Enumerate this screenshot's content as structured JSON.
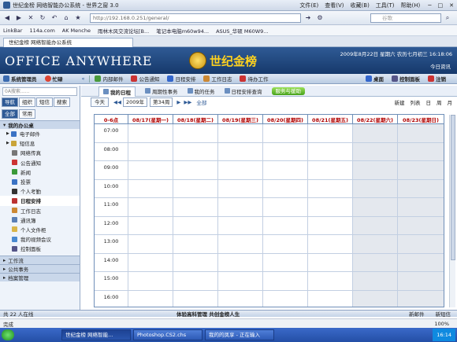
{
  "browser": {
    "title": "世纪金榜 网络智能办公系统 - 世界之窗 3.0",
    "menu": [
      "文件(E)",
      "查看(V)",
      "收藏(B)",
      "工具(T)",
      "帮助(H)"
    ],
    "address": "http://192.168.0.251/general/",
    "search_placeholder": "谷歌",
    "favorites": [
      "LinkBar",
      "114a.com",
      "AK Menche",
      "雨林木风交流论坛[B...",
      "笔记本电脑m60w94...",
      "ASUS_华硕 M60W9..."
    ],
    "tab_title": "世纪金榜 网络智能办公系统"
  },
  "header": {
    "logo": "OFFICE ANYWHERE",
    "brand": "世纪金榜",
    "date": "2009年8月22日 星期六 农历七月初三  16:18:06",
    "today_link": "今日资讯"
  },
  "nav": {
    "user": "系统管理员",
    "status": "忙碌",
    "items": [
      "内部邮件",
      "公告通知",
      "日程安排",
      "工作日志",
      "待办工作"
    ],
    "right": [
      "桌面",
      "控制面板",
      "注销"
    ]
  },
  "sidebar": {
    "search_placeholder": "0A搜索......",
    "tabs": [
      "导航",
      "组织",
      "短信",
      "搜索"
    ],
    "subtabs": [
      "全部",
      "常用"
    ],
    "section": "我的办公桌",
    "items": [
      "电子邮件",
      "短信息",
      "网络传真",
      "公告通知",
      "新闻",
      "投票",
      "个人考勤",
      "日程安排",
      "工作日志",
      "通讯簿",
      "个人文件柜",
      "我的视频会议",
      "控制面板"
    ],
    "groups": [
      "工作流",
      "公共事务",
      "档案管理"
    ]
  },
  "calendar": {
    "tabs": [
      "我的日程",
      "周期性事务",
      "我的任务",
      "日程安排查询"
    ],
    "help": "服务与援助",
    "today_button": "今天",
    "year": "2009年",
    "week": "第34周",
    "all": "全部",
    "new": "新建",
    "views": [
      "列表",
      "日",
      "周",
      "月"
    ],
    "corner": "0-6点",
    "days": [
      "08/17(星期一)",
      "08/18(星期二)",
      "08/19(星期三)",
      "08/20(星期四)",
      "08/21(星期五)",
      "08/22(星期六)",
      "08/23(星期日)"
    ],
    "times": [
      "07:00",
      "08:00",
      "09:00",
      "10:00",
      "11:00",
      "12:00",
      "13:00",
      "14:00",
      "15:00",
      "16:00"
    ]
  },
  "footer": {
    "online": "共 22 人在线",
    "slogan": "体验高科管理  共创金榜人生",
    "new_mail": "新邮件",
    "new_sms": "新短信"
  },
  "status": {
    "text": "完成",
    "zoom": "100%"
  },
  "taskbar": {
    "tasks": [
      "世纪金榜 网络智能...",
      "Photoshop.CS2.chs",
      "我的的凤享 - 正在输入"
    ],
    "clock": "16:14"
  },
  "colors": {
    "header_bg": "#16396b",
    "accent": "#2e5a96",
    "day_header_text": "#b00000",
    "weekend_bg": "#e4e8ee"
  }
}
